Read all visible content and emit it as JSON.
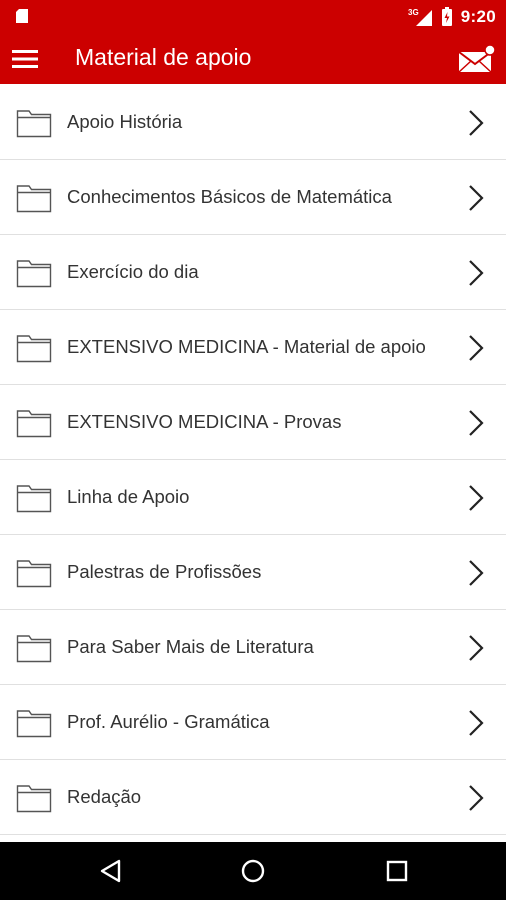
{
  "status_bar": {
    "time": "9:20",
    "network": "3G",
    "left_icon": "sd-card-icon",
    "signal_icon": "signal-icon",
    "battery_icon": "battery-icon"
  },
  "app_bar": {
    "title": "Material de apoio",
    "menu_icon": "hamburger-menu-icon",
    "mail_icon": "mail-notification-icon"
  },
  "colors": {
    "primary": "#cc0000",
    "text": "#333333",
    "divider": "#e0e0e0",
    "nav_background": "#000000"
  },
  "folders": [
    {
      "label": "Apoio História"
    },
    {
      "label": "Conhecimentos Básicos de Matemática"
    },
    {
      "label": "Exercício do dia"
    },
    {
      "label": "EXTENSIVO MEDICINA - Material de apoio"
    },
    {
      "label": "EXTENSIVO MEDICINA - Provas"
    },
    {
      "label": "Linha de Apoio"
    },
    {
      "label": "Palestras de Profissões"
    },
    {
      "label": "Para Saber Mais de Literatura"
    },
    {
      "label": "Prof. Aurélio - Gramática"
    },
    {
      "label": "Redação"
    }
  ],
  "nav_bar": {
    "back_icon": "back-triangle-icon",
    "home_icon": "home-circle-icon",
    "recents_icon": "recents-square-icon"
  }
}
